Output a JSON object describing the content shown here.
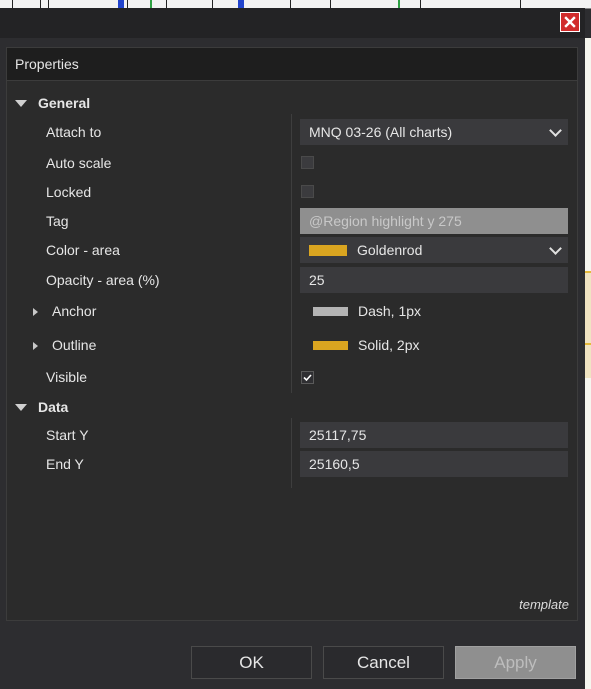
{
  "dialog": {
    "close_label": "✕"
  },
  "panel": {
    "title": "Properties",
    "footer_note": "template"
  },
  "sections": {
    "general": "General",
    "data": "Data"
  },
  "general": {
    "attach_to": {
      "label": "Attach to",
      "value": "MNQ 03-26 (All charts)"
    },
    "auto_scale": {
      "label": "Auto scale",
      "checked": false
    },
    "locked": {
      "label": "Locked",
      "checked": false
    },
    "tag": {
      "label": "Tag",
      "placeholder": "@Region highlight y 275"
    },
    "color_area": {
      "label": "Color - area",
      "value": "Goldenrod",
      "swatch": "#DAA520"
    },
    "opacity_area": {
      "label": "Opacity - area (%)",
      "value": "25"
    },
    "anchor": {
      "label": "Anchor",
      "value": "Dash, 1px",
      "swatch": "#b4b4b4"
    },
    "outline": {
      "label": "Outline",
      "value": "Solid, 2px",
      "swatch": "#DAA520"
    },
    "visible": {
      "label": "Visible",
      "checked": true,
      "check_glyph": "✓"
    }
  },
  "data": {
    "start_y": {
      "label": "Start Y",
      "value": "25117,75"
    },
    "end_y": {
      "label": "End Y",
      "value": "25160,5"
    }
  },
  "buttons": {
    "ok": "OK",
    "cancel": "Cancel",
    "apply": "Apply"
  },
  "colors": {
    "accent_close": "#d12b2b",
    "disabled_field": "#8f8f8f"
  }
}
